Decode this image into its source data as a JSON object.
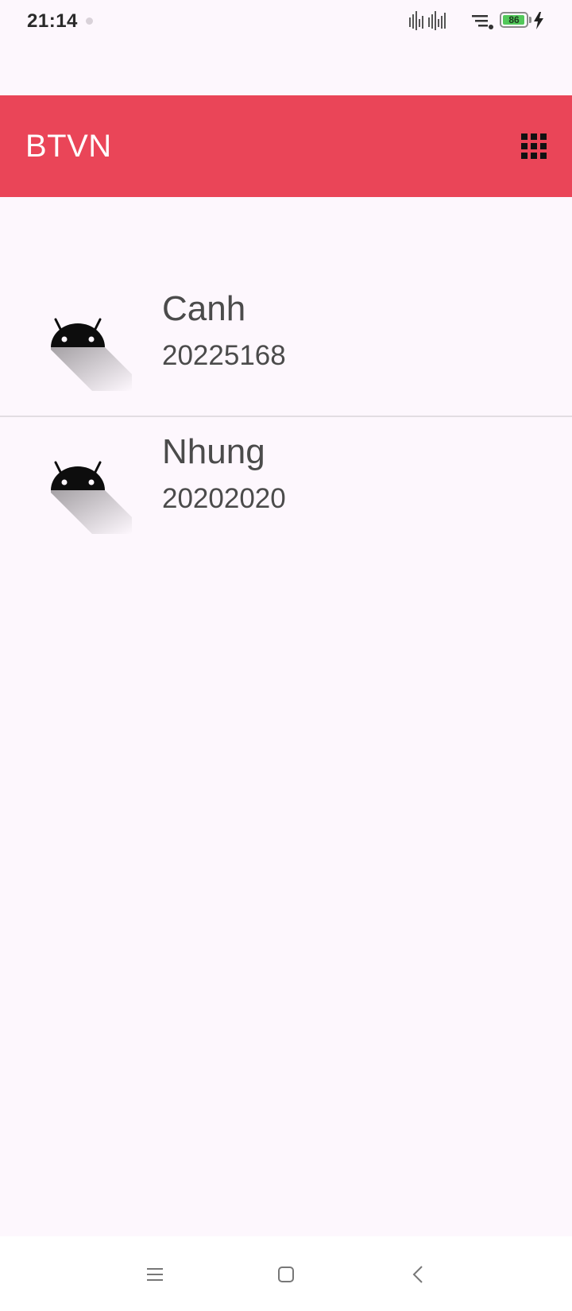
{
  "status_bar": {
    "time": "21:14",
    "battery_level": "86",
    "icons": [
      "signal-icon",
      "wifi-icon",
      "battery-icon",
      "charging-icon"
    ]
  },
  "app_bar": {
    "title": "BTVN",
    "action_icon": "grid-icon",
    "background_color": "#ea4558"
  },
  "list": {
    "items": [
      {
        "name": "Canh",
        "id": "20225168",
        "icon": "android-icon"
      },
      {
        "name": "Nhung",
        "id": "20202020",
        "icon": "android-icon"
      }
    ]
  },
  "nav_bar": {
    "buttons": [
      "menu-icon",
      "home-icon",
      "back-icon"
    ]
  }
}
